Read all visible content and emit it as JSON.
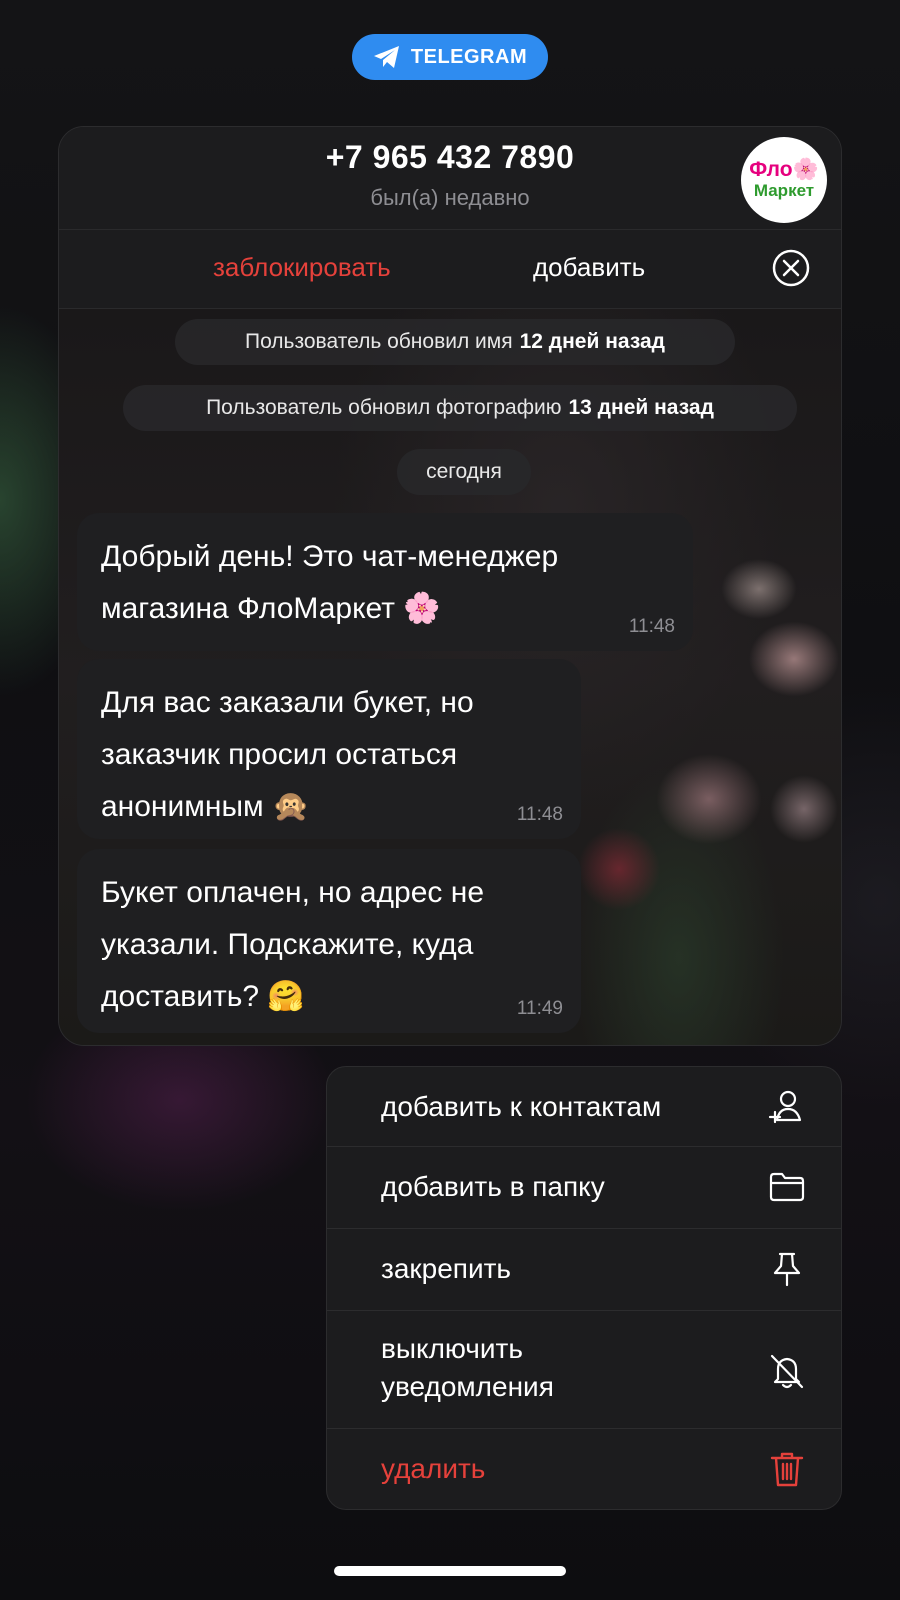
{
  "source": {
    "label": "TELEGRAM",
    "color": "#2f8cf0"
  },
  "contact": {
    "phone": "+7 965 432 7890",
    "status": "был(а) недавно",
    "avatar": {
      "line1": "Фло🌸",
      "line2": "Маркет"
    }
  },
  "actions": {
    "block_label": "заблокировать",
    "add_label": "добавить",
    "close_icon": "close-circle-icon"
  },
  "system_messages": [
    {
      "text": "Пользователь обновил имя",
      "bold": "12 дней назад"
    },
    {
      "text": "Пользователь обновил фотографию",
      "bold": "13 дней назад"
    }
  ],
  "date_separator": "сегодня",
  "messages": [
    {
      "lines": [
        "Добрый день! Это чат-менеджер",
        "магазина ФлоМаркет 🌸"
      ],
      "time": "11:48"
    },
    {
      "lines": [
        "Для вас заказали букет, но",
        "заказчик просил остаться",
        "анонимным 🙊"
      ],
      "time": "11:48"
    },
    {
      "lines": [
        "Букет оплачен, но адрес не",
        "указали. Подскажите, куда",
        "доставить? 🤗"
      ],
      "time": "11:49"
    }
  ],
  "menu": [
    {
      "label": "добавить к контактам",
      "icon": "add-contact-icon"
    },
    {
      "label": "добавить в папку",
      "icon": "folder-icon"
    },
    {
      "label": "закрепить",
      "icon": "pin-icon"
    },
    {
      "label_line1": "выключить",
      "label_line2": "уведомления",
      "icon": "bell-off-icon"
    },
    {
      "label": "удалить",
      "icon": "trash-icon",
      "color": "#e5413b"
    }
  ]
}
